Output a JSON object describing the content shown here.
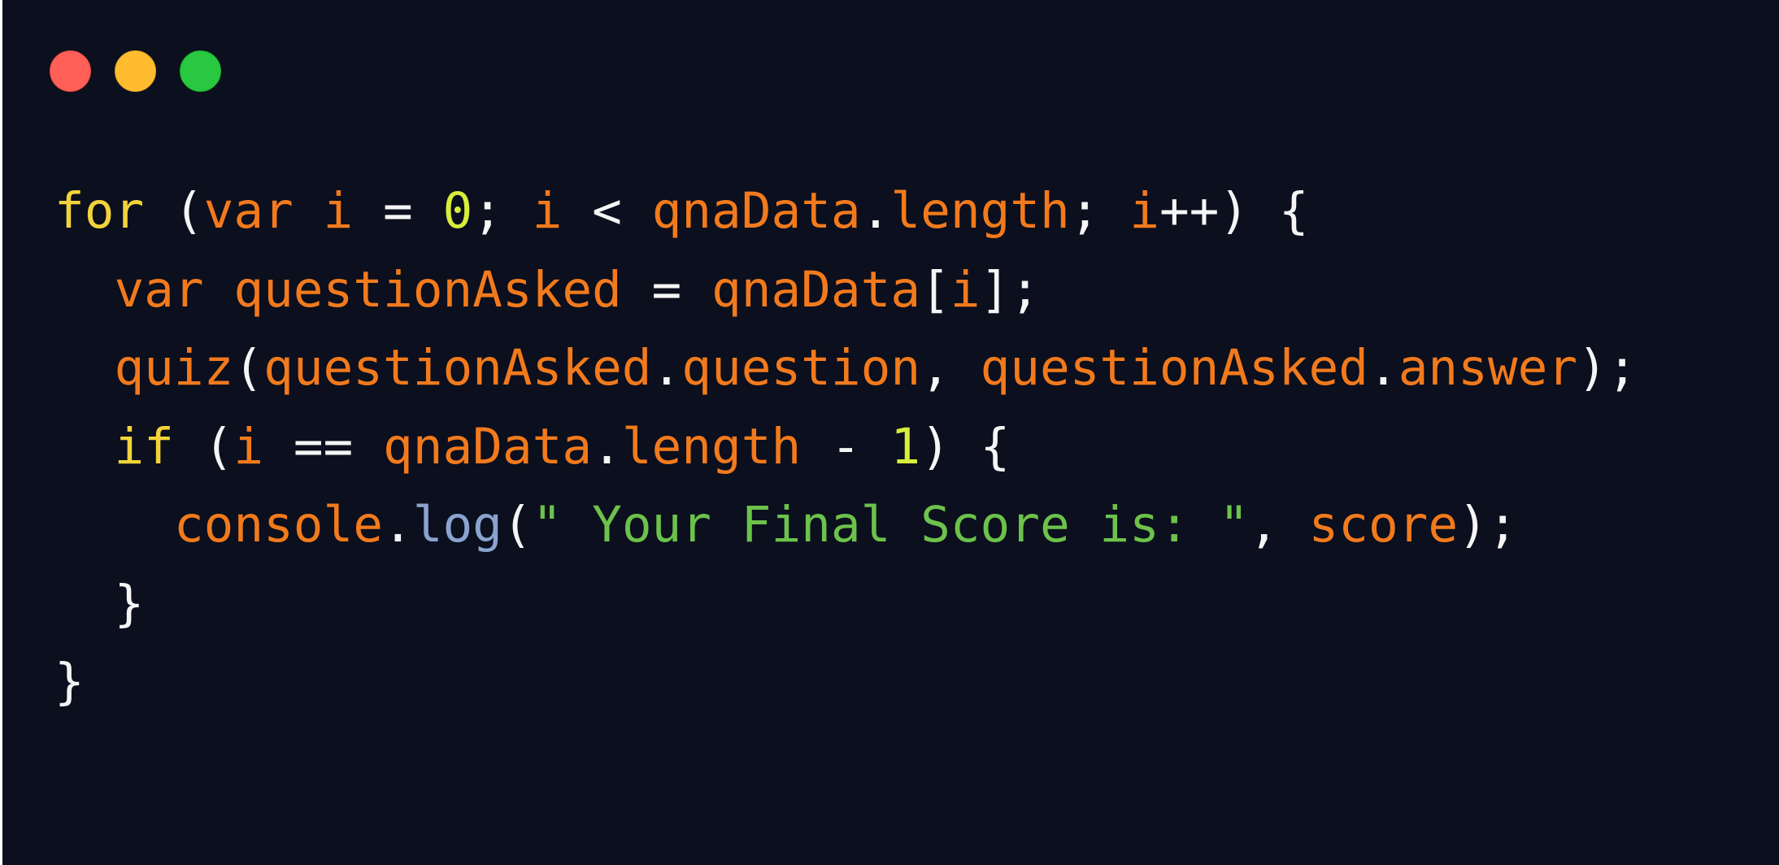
{
  "window": {
    "controls": [
      {
        "name": "close",
        "color": "#fe5f57",
        "border": "#e0443e"
      },
      {
        "name": "minimize",
        "color": "#febc2e",
        "border": "#dea123"
      },
      {
        "name": "maximize",
        "color": "#28c840",
        "border": "#1aab29"
      }
    ]
  },
  "theme": {
    "background": "#0b0f1e",
    "keyword": "#f2d43a",
    "identifier": "#f27a1c",
    "number": "#d8ee3b",
    "string": "#6cc24a",
    "method": "#8aa3cf",
    "punctuation": "#f5f5f5"
  },
  "code": {
    "lines": [
      [
        {
          "t": "kw",
          "v": "for"
        },
        {
          "t": "pun",
          "v": " ("
        },
        {
          "t": "var",
          "v": "var i"
        },
        {
          "t": "pun",
          "v": " = "
        },
        {
          "t": "num",
          "v": "0"
        },
        {
          "t": "pun",
          "v": "; "
        },
        {
          "t": "var",
          "v": "i"
        },
        {
          "t": "pun",
          "v": " < "
        },
        {
          "t": "var",
          "v": "qnaData"
        },
        {
          "t": "pun",
          "v": "."
        },
        {
          "t": "var",
          "v": "length"
        },
        {
          "t": "pun",
          "v": "; "
        },
        {
          "t": "var",
          "v": "i"
        },
        {
          "t": "pun",
          "v": "++) {"
        }
      ],
      [
        {
          "t": "pun",
          "v": "  "
        },
        {
          "t": "var",
          "v": "var questionAsked"
        },
        {
          "t": "pun",
          "v": " = "
        },
        {
          "t": "var",
          "v": "qnaData"
        },
        {
          "t": "pun",
          "v": "["
        },
        {
          "t": "var",
          "v": "i"
        },
        {
          "t": "pun",
          "v": "];"
        }
      ],
      [
        {
          "t": "pun",
          "v": "  "
        },
        {
          "t": "var",
          "v": "quiz"
        },
        {
          "t": "pun",
          "v": "("
        },
        {
          "t": "var",
          "v": "questionAsked"
        },
        {
          "t": "pun",
          "v": "."
        },
        {
          "t": "var",
          "v": "question"
        },
        {
          "t": "pun",
          "v": ", "
        },
        {
          "t": "var",
          "v": "questionAsked"
        },
        {
          "t": "pun",
          "v": "."
        },
        {
          "t": "var",
          "v": "answer"
        },
        {
          "t": "pun",
          "v": ");"
        }
      ],
      [
        {
          "t": "pun",
          "v": "  "
        },
        {
          "t": "kw",
          "v": "if"
        },
        {
          "t": "pun",
          "v": " ("
        },
        {
          "t": "var",
          "v": "i"
        },
        {
          "t": "pun",
          "v": " == "
        },
        {
          "t": "var",
          "v": "qnaData"
        },
        {
          "t": "pun",
          "v": "."
        },
        {
          "t": "var",
          "v": "length"
        },
        {
          "t": "pun",
          "v": " - "
        },
        {
          "t": "num",
          "v": "1"
        },
        {
          "t": "pun",
          "v": ") {"
        }
      ],
      [
        {
          "t": "pun",
          "v": "    "
        },
        {
          "t": "var",
          "v": "console"
        },
        {
          "t": "pun",
          "v": "."
        },
        {
          "t": "fn",
          "v": "log"
        },
        {
          "t": "pun",
          "v": "("
        },
        {
          "t": "str",
          "v": "\" Your Final Score is: \""
        },
        {
          "t": "pun",
          "v": ", "
        },
        {
          "t": "var",
          "v": "score"
        },
        {
          "t": "pun",
          "v": ");"
        }
      ],
      [
        {
          "t": "pun",
          "v": "  }"
        }
      ],
      [
        {
          "t": "pun",
          "v": "}"
        }
      ]
    ]
  }
}
